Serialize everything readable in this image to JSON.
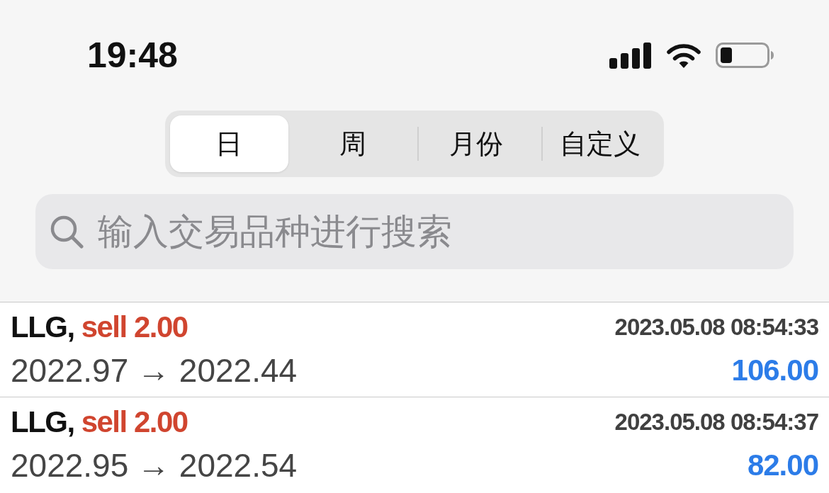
{
  "status_bar": {
    "time": "19:48"
  },
  "period_tabs": [
    {
      "label": "日",
      "selected": true
    },
    {
      "label": "周",
      "selected": false
    },
    {
      "label": "月份",
      "selected": false
    },
    {
      "label": "自定义",
      "selected": false
    }
  ],
  "search": {
    "placeholder": "输入交易品种进行搜索"
  },
  "trades": [
    {
      "symbol": "LLG,",
      "order": "sell 2.00",
      "time": "2023.05.08 08:54:33",
      "prices": "2022.97 → 2022.44",
      "profit": "106.00"
    },
    {
      "symbol": "LLG,",
      "order": "sell 2.00",
      "time": "2023.05.08 08:54:37",
      "prices": "2022.95 → 2022.54",
      "profit": "82.00"
    }
  ]
}
